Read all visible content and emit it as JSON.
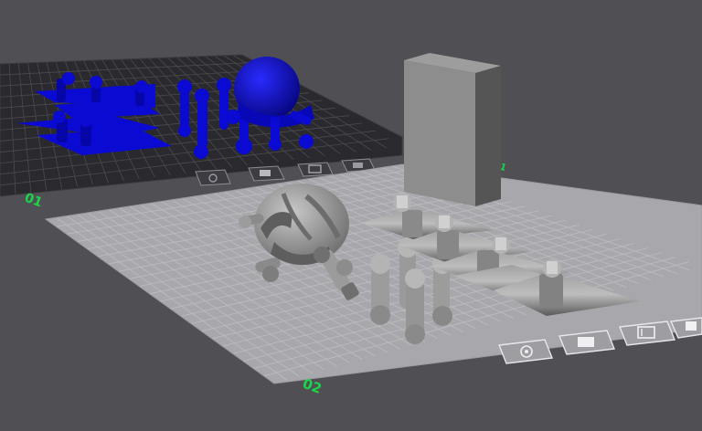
{
  "viewport": {
    "background": "#505054",
    "plates": [
      {
        "id": "plate-1",
        "label": "01",
        "selected": true,
        "surface": "#2a2a2e",
        "grid": "#4a4a50"
      },
      {
        "id": "plate-2",
        "label": "02",
        "selected": false,
        "surface": "#a8a8ac",
        "grid": "#bdbdc1"
      }
    ],
    "plate_buttons": [
      "import-icon",
      "arrange-icon",
      "settings-icon",
      "lock-icon"
    ],
    "colors": {
      "selected_model": "#0a0ad2",
      "model": "#8e8e8e",
      "label": "#19d64a"
    }
  }
}
